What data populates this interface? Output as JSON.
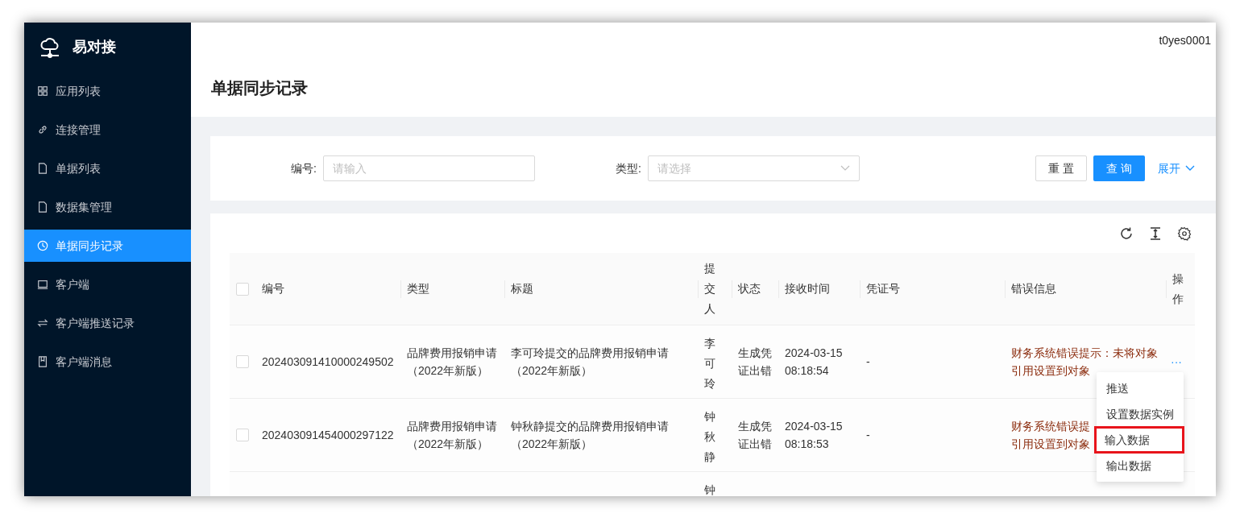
{
  "app": {
    "name": "易对接"
  },
  "sidebar": {
    "items": [
      {
        "label": "应用列表",
        "selected": false
      },
      {
        "label": "连接管理",
        "selected": false
      },
      {
        "label": "单据列表",
        "selected": false
      },
      {
        "label": "数据集管理",
        "selected": false
      },
      {
        "label": "单据同步记录",
        "selected": true
      },
      {
        "label": "客户端",
        "selected": false
      },
      {
        "label": "客户端推送记录",
        "selected": false
      },
      {
        "label": "客户端消息",
        "selected": false
      }
    ]
  },
  "header": {
    "user": "t0yes0001"
  },
  "page_title": "单据同步记录",
  "search": {
    "fields": [
      {
        "label": "编号:",
        "kind": "input",
        "placeholder": "请输入"
      },
      {
        "label": "类型:",
        "kind": "select",
        "placeholder": "请选择"
      }
    ],
    "reset": "重 置",
    "query": "查 询",
    "expand": "展开"
  },
  "table": {
    "all_checked": false,
    "columns": [
      "编号",
      "类型",
      "标题",
      "提交人",
      "状态",
      "接收时间",
      "凭证号",
      "错误信息",
      "操作"
    ],
    "rows": [
      {
        "checked": false,
        "cells": [
          "202403091410000249502",
          "品牌费用报销申请（2022年新版）",
          "李可玲提交的品牌费用报销申请（2022年新版）",
          "李可玲",
          "生成凭证出错",
          "2024-03-15 08:18:54",
          "-"
        ],
        "error_lines": [
          "财务系统错误提示：未将对象",
          "引用设置到对象"
        ],
        "action": "···"
      },
      {
        "checked": false,
        "cells": [
          "202403091454000297122",
          "品牌费用报销申请（2022年新版）",
          "钟秋静提交的品牌费用报销申请（2022年新版）",
          "钟秋静",
          "生成凭证出错",
          "2024-03-15 08:18:53",
          "-"
        ],
        "error_lines": [
          "财务系统错误提",
          "引用设置到对象"
        ]
      },
      {
        "cells": [
          "",
          "",
          "",
          "钟",
          "",
          "",
          ""
        ],
        "error_lines": []
      }
    ]
  },
  "menu": {
    "items": [
      {
        "label": "推送",
        "highlighted": false
      },
      {
        "label": "设置数据实例",
        "highlighted": false
      },
      {
        "label": "输入数据",
        "highlighted": true
      },
      {
        "label": "输出数据",
        "highlighted": false
      }
    ]
  }
}
